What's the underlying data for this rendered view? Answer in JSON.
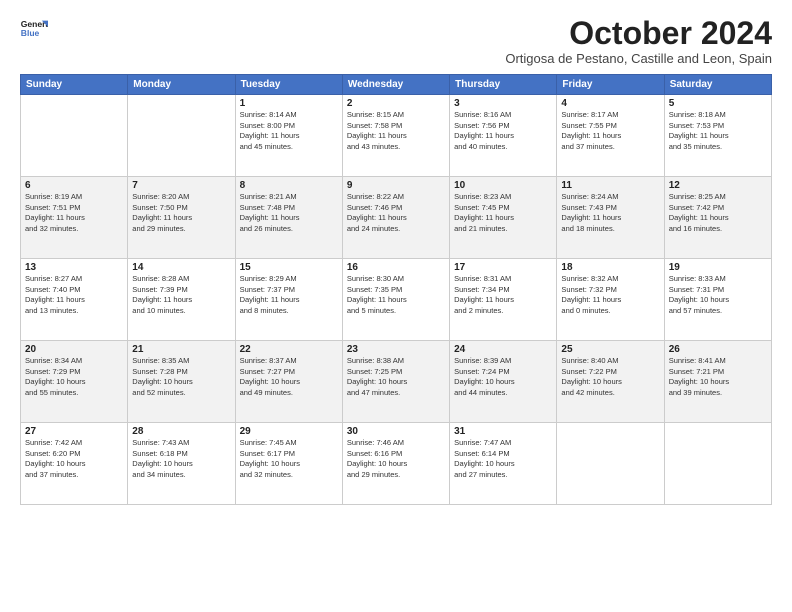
{
  "logo": {
    "line1": "General",
    "line2": "Blue"
  },
  "title": "October 2024",
  "subtitle": "Ortigosa de Pestano, Castille and Leon, Spain",
  "weekdays": [
    "Sunday",
    "Monday",
    "Tuesday",
    "Wednesday",
    "Thursday",
    "Friday",
    "Saturday"
  ],
  "weeks": [
    [
      {
        "day": "",
        "info": ""
      },
      {
        "day": "",
        "info": ""
      },
      {
        "day": "1",
        "info": "Sunrise: 8:14 AM\nSunset: 8:00 PM\nDaylight: 11 hours\nand 45 minutes."
      },
      {
        "day": "2",
        "info": "Sunrise: 8:15 AM\nSunset: 7:58 PM\nDaylight: 11 hours\nand 43 minutes."
      },
      {
        "day": "3",
        "info": "Sunrise: 8:16 AM\nSunset: 7:56 PM\nDaylight: 11 hours\nand 40 minutes."
      },
      {
        "day": "4",
        "info": "Sunrise: 8:17 AM\nSunset: 7:55 PM\nDaylight: 11 hours\nand 37 minutes."
      },
      {
        "day": "5",
        "info": "Sunrise: 8:18 AM\nSunset: 7:53 PM\nDaylight: 11 hours\nand 35 minutes."
      }
    ],
    [
      {
        "day": "6",
        "info": "Sunrise: 8:19 AM\nSunset: 7:51 PM\nDaylight: 11 hours\nand 32 minutes."
      },
      {
        "day": "7",
        "info": "Sunrise: 8:20 AM\nSunset: 7:50 PM\nDaylight: 11 hours\nand 29 minutes."
      },
      {
        "day": "8",
        "info": "Sunrise: 8:21 AM\nSunset: 7:48 PM\nDaylight: 11 hours\nand 26 minutes."
      },
      {
        "day": "9",
        "info": "Sunrise: 8:22 AM\nSunset: 7:46 PM\nDaylight: 11 hours\nand 24 minutes."
      },
      {
        "day": "10",
        "info": "Sunrise: 8:23 AM\nSunset: 7:45 PM\nDaylight: 11 hours\nand 21 minutes."
      },
      {
        "day": "11",
        "info": "Sunrise: 8:24 AM\nSunset: 7:43 PM\nDaylight: 11 hours\nand 18 minutes."
      },
      {
        "day": "12",
        "info": "Sunrise: 8:25 AM\nSunset: 7:42 PM\nDaylight: 11 hours\nand 16 minutes."
      }
    ],
    [
      {
        "day": "13",
        "info": "Sunrise: 8:27 AM\nSunset: 7:40 PM\nDaylight: 11 hours\nand 13 minutes."
      },
      {
        "day": "14",
        "info": "Sunrise: 8:28 AM\nSunset: 7:39 PM\nDaylight: 11 hours\nand 10 minutes."
      },
      {
        "day": "15",
        "info": "Sunrise: 8:29 AM\nSunset: 7:37 PM\nDaylight: 11 hours\nand 8 minutes."
      },
      {
        "day": "16",
        "info": "Sunrise: 8:30 AM\nSunset: 7:35 PM\nDaylight: 11 hours\nand 5 minutes."
      },
      {
        "day": "17",
        "info": "Sunrise: 8:31 AM\nSunset: 7:34 PM\nDaylight: 11 hours\nand 2 minutes."
      },
      {
        "day": "18",
        "info": "Sunrise: 8:32 AM\nSunset: 7:32 PM\nDaylight: 11 hours\nand 0 minutes."
      },
      {
        "day": "19",
        "info": "Sunrise: 8:33 AM\nSunset: 7:31 PM\nDaylight: 10 hours\nand 57 minutes."
      }
    ],
    [
      {
        "day": "20",
        "info": "Sunrise: 8:34 AM\nSunset: 7:29 PM\nDaylight: 10 hours\nand 55 minutes."
      },
      {
        "day": "21",
        "info": "Sunrise: 8:35 AM\nSunset: 7:28 PM\nDaylight: 10 hours\nand 52 minutes."
      },
      {
        "day": "22",
        "info": "Sunrise: 8:37 AM\nSunset: 7:27 PM\nDaylight: 10 hours\nand 49 minutes."
      },
      {
        "day": "23",
        "info": "Sunrise: 8:38 AM\nSunset: 7:25 PM\nDaylight: 10 hours\nand 47 minutes."
      },
      {
        "day": "24",
        "info": "Sunrise: 8:39 AM\nSunset: 7:24 PM\nDaylight: 10 hours\nand 44 minutes."
      },
      {
        "day": "25",
        "info": "Sunrise: 8:40 AM\nSunset: 7:22 PM\nDaylight: 10 hours\nand 42 minutes."
      },
      {
        "day": "26",
        "info": "Sunrise: 8:41 AM\nSunset: 7:21 PM\nDaylight: 10 hours\nand 39 minutes."
      }
    ],
    [
      {
        "day": "27",
        "info": "Sunrise: 7:42 AM\nSunset: 6:20 PM\nDaylight: 10 hours\nand 37 minutes."
      },
      {
        "day": "28",
        "info": "Sunrise: 7:43 AM\nSunset: 6:18 PM\nDaylight: 10 hours\nand 34 minutes."
      },
      {
        "day": "29",
        "info": "Sunrise: 7:45 AM\nSunset: 6:17 PM\nDaylight: 10 hours\nand 32 minutes."
      },
      {
        "day": "30",
        "info": "Sunrise: 7:46 AM\nSunset: 6:16 PM\nDaylight: 10 hours\nand 29 minutes."
      },
      {
        "day": "31",
        "info": "Sunrise: 7:47 AM\nSunset: 6:14 PM\nDaylight: 10 hours\nand 27 minutes."
      },
      {
        "day": "",
        "info": ""
      },
      {
        "day": "",
        "info": ""
      }
    ]
  ]
}
